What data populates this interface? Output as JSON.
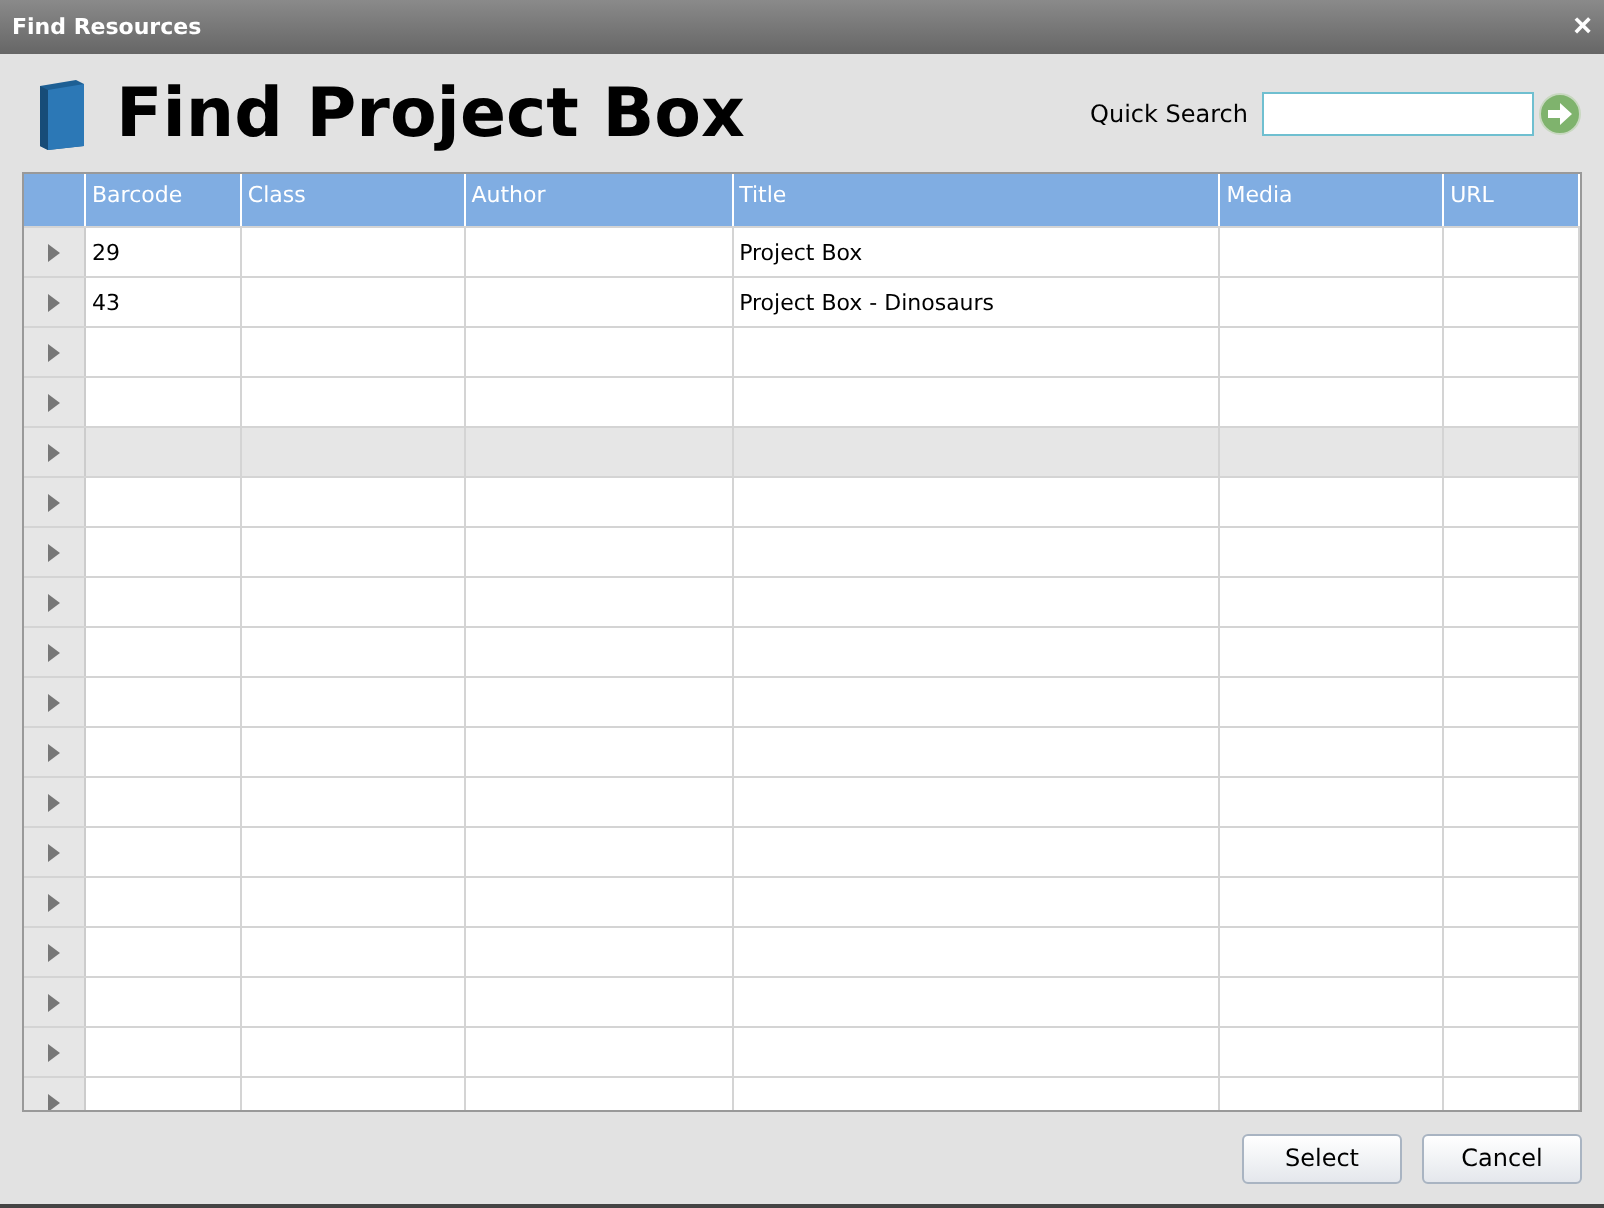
{
  "window": {
    "title": "Find Resources",
    "close": "×"
  },
  "heading": "Find Project Box",
  "quick_search": {
    "label": "Quick Search"
  },
  "table": {
    "columns": [
      "Barcode",
      "Class",
      "Author",
      "Title",
      "Media",
      "URL"
    ],
    "rows": [
      {
        "selected": false,
        "cells": [
          "29",
          null,
          null,
          "Project Box",
          null,
          null
        ]
      },
      {
        "selected": false,
        "cells": [
          "43",
          null,
          null,
          "Project Box - Dinosaurs",
          null,
          null
        ]
      },
      {
        "selected": false
      },
      {
        "selected": false
      },
      {
        "selected": true
      },
      {
        "selected": false
      },
      {
        "selected": false
      },
      {
        "selected": false
      },
      {
        "selected": false
      },
      {
        "selected": false
      },
      {
        "selected": false
      },
      {
        "selected": false
      },
      {
        "selected": false
      },
      {
        "selected": false
      },
      {
        "selected": false
      },
      {
        "selected": false
      },
      {
        "selected": false
      },
      {
        "selected": false
      }
    ]
  },
  "buttons": [
    "Select",
    "Cancel"
  ]
}
